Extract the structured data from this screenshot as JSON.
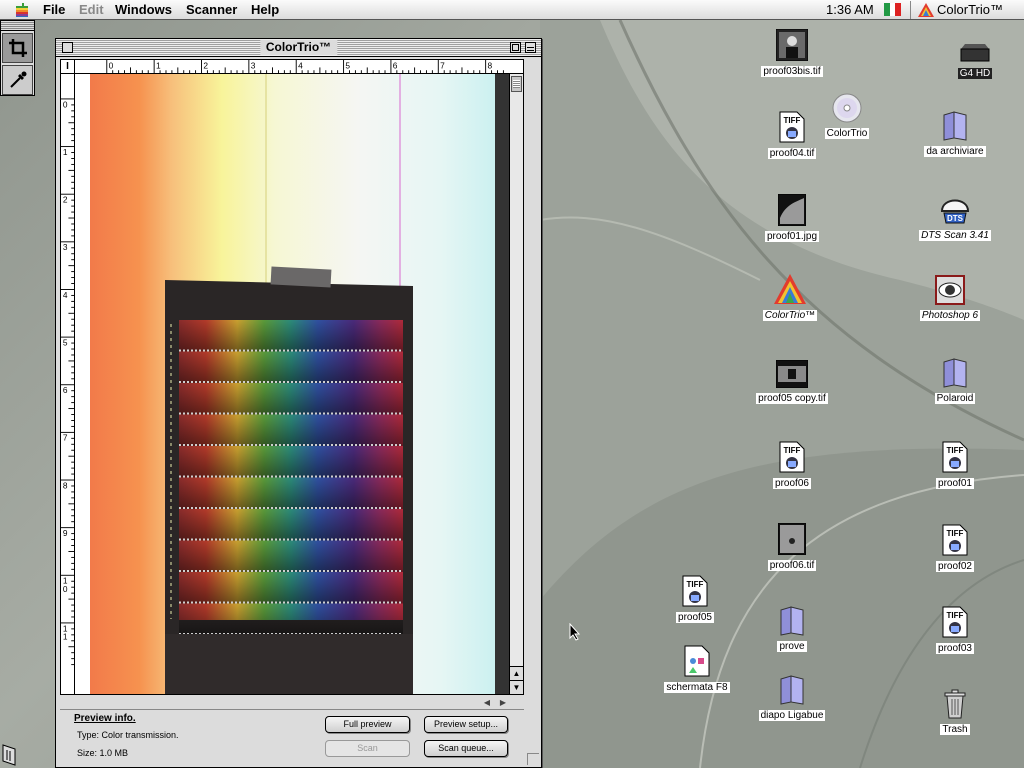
{
  "menubar": {
    "file": "File",
    "edit": "Edit",
    "windows": "Windows",
    "scanner": "Scanner",
    "help": "Help",
    "clock": "1:36 AM",
    "app_name": "ColorTrio™",
    "flag_colors": [
      "#229944",
      "#ffffff",
      "#dd2222"
    ]
  },
  "window": {
    "title": "ColorTrio™",
    "corner_label": "I",
    "ruler_top_ticks": [
      "0",
      "1",
      "2",
      "3",
      "4",
      "5",
      "6",
      "7",
      "8"
    ],
    "ruler_left_ticks": [
      "0",
      "1",
      "2",
      "3",
      "4",
      "5",
      "6",
      "7",
      "8",
      "9",
      "10",
      "11"
    ],
    "info": {
      "title": "Preview info.",
      "type": "Type: Color transmission.",
      "size": "Size: 1.0 MB"
    },
    "buttons": {
      "full_preview": "Full preview",
      "preview_setup": "Preview setup...",
      "scan": "Scan",
      "scan_queue": "Scan queue..."
    }
  },
  "desktop": {
    "icons": [
      {
        "id": "proof03bis",
        "label": "proof03bis.tif",
        "kind": "photo-thumb"
      },
      {
        "id": "g4hd",
        "label": "G4 HD",
        "kind": "hard-drive"
      },
      {
        "id": "colortrio-cd",
        "label": "ColorTrio",
        "kind": "cd"
      },
      {
        "id": "proof04",
        "label": "proof04.tif",
        "kind": "tiff"
      },
      {
        "id": "da-archiviare",
        "label": "da archiviare",
        "kind": "folder"
      },
      {
        "id": "proof01jpg",
        "label": "proof01.jpg",
        "kind": "photo-thumb"
      },
      {
        "id": "dts-scan",
        "label": "DTS Scan 3.41",
        "kind": "app-alias"
      },
      {
        "id": "colortrio-app",
        "label": "ColorTrio™",
        "kind": "app-alias"
      },
      {
        "id": "photoshop",
        "label": "Photoshop 6",
        "kind": "app-alias"
      },
      {
        "id": "proof05copy",
        "label": "proof05 copy.tif",
        "kind": "photo-thumb"
      },
      {
        "id": "polaroid",
        "label": "Polaroid",
        "kind": "folder"
      },
      {
        "id": "proof06",
        "label": "proof06",
        "kind": "tiff"
      },
      {
        "id": "proof01",
        "label": "proof01",
        "kind": "tiff"
      },
      {
        "id": "proof06tif",
        "label": "proof06.tif",
        "kind": "photo-thumb"
      },
      {
        "id": "proof02",
        "label": "proof02",
        "kind": "tiff"
      },
      {
        "id": "proof05",
        "label": "proof05",
        "kind": "tiff"
      },
      {
        "id": "prove",
        "label": "prove",
        "kind": "folder"
      },
      {
        "id": "proof03",
        "label": "proof03",
        "kind": "tiff"
      },
      {
        "id": "schermata",
        "label": "schermata F8",
        "kind": "document"
      },
      {
        "id": "diapo",
        "label": "diapo Ligabue",
        "kind": "folder"
      },
      {
        "id": "trash",
        "label": "Trash",
        "kind": "trash"
      }
    ]
  }
}
